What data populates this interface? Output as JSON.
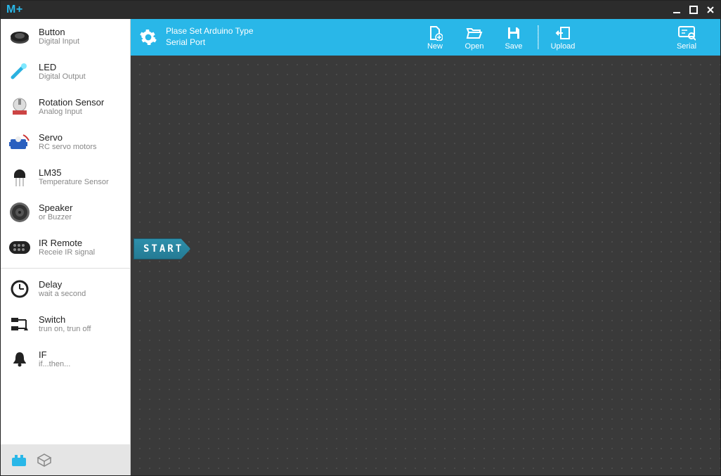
{
  "window_title": "M+",
  "status": {
    "line1": "Plase Set Arduino Type",
    "line2": "Serial Port"
  },
  "toolbar": {
    "new": "New",
    "open": "Open",
    "save": "Save",
    "upload": "Upload",
    "serial": "Serial"
  },
  "sidebar": {
    "items": [
      {
        "title": "Button",
        "sub": "Digital Input"
      },
      {
        "title": "LED",
        "sub": "Digital Output"
      },
      {
        "title": "Rotation Sensor",
        "sub": "Analog Input"
      },
      {
        "title": "Servo",
        "sub": "RC servo motors"
      },
      {
        "title": "LM35",
        "sub": "Temperature Sensor"
      },
      {
        "title": "Speaker",
        "sub": "or Buzzer"
      },
      {
        "title": "IR Remote",
        "sub": "Receie IR signal"
      }
    ],
    "logic": [
      {
        "title": "Delay",
        "sub": "wait a second"
      },
      {
        "title": "Switch",
        "sub": "trun on, trun off"
      },
      {
        "title": "IF",
        "sub": "if...then..."
      }
    ]
  },
  "canvas": {
    "start_label": "START"
  }
}
